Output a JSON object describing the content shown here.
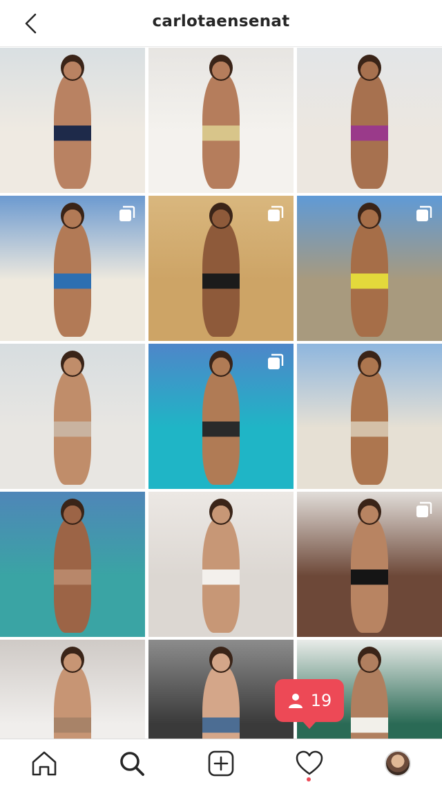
{
  "header": {
    "username": "carlotaensenat",
    "back_icon": "chevron-left-icon"
  },
  "grid": {
    "columns": 3,
    "tiles": [
      {
        "id": "post-1",
        "multi": false,
        "sky": "#d9dfe2",
        "ground": "#efeae2",
        "fig": "#b98262",
        "accent": "#1e2a4a"
      },
      {
        "id": "post-2",
        "multi": false,
        "sky": "#e7e5e2",
        "ground": "#f4f2ee",
        "fig": "#b57d5c",
        "accent": "#d8c58a"
      },
      {
        "id": "post-3",
        "multi": false,
        "sky": "#e3e6e8",
        "ground": "#ece7e0",
        "fig": "#a7714f",
        "accent": "#9a3a8a"
      },
      {
        "id": "post-4",
        "multi": true,
        "sky": "#6c9ad0",
        "ground": "#eee9de",
        "fig": "#b27a56",
        "accent": "#2d6fb1"
      },
      {
        "id": "post-5",
        "multi": true,
        "sky": "#d9b77e",
        "ground": "#cda466",
        "fig": "#8e5a3a",
        "accent": "#1b1b1b"
      },
      {
        "id": "post-6",
        "multi": true,
        "sky": "#5f9ad6",
        "ground": "#a89a7e",
        "fig": "#a66e48",
        "accent": "#e3d93b"
      },
      {
        "id": "post-7",
        "multi": false,
        "sky": "#d7dde0",
        "ground": "#e8e6e2",
        "fig": "#c08d6a",
        "accent": "#c9b3a0"
      },
      {
        "id": "post-8",
        "multi": true,
        "sky": "#4e86c9",
        "ground": "#1fb5c6",
        "fig": "#b07b55",
        "accent": "#2a2a2a"
      },
      {
        "id": "post-9",
        "multi": false,
        "sky": "#8eb6de",
        "ground": "#e6e0d4",
        "fig": "#ad764f",
        "accent": "#d4c0a8"
      },
      {
        "id": "post-10",
        "multi": false,
        "sky": "#4f86b8",
        "ground": "#3aa4a4",
        "fig": "#9c6446",
        "accent": "#b8876a"
      },
      {
        "id": "post-11",
        "multi": false,
        "sky": "#ece8e4",
        "ground": "#dcd7d2",
        "fig": "#c79776",
        "accent": "#f3f0ec"
      },
      {
        "id": "post-12",
        "multi": true,
        "sky": "#e1ddd9",
        "ground": "#6d4838",
        "fig": "#b88462",
        "accent": "#151515"
      },
      {
        "id": "post-13",
        "multi": false,
        "sky": "#cfcac6",
        "ground": "#f0eeec",
        "fig": "#c79574",
        "accent": "#a88368"
      },
      {
        "id": "post-14",
        "multi": false,
        "sky": "#8c8c8c",
        "ground": "#3a3a3a",
        "fig": "#d4a689",
        "accent": "#4c6d93"
      },
      {
        "id": "post-15",
        "multi": false,
        "sky": "#e9ece9",
        "ground": "#2a6a55",
        "fig": "#b07f5f",
        "accent": "#f2f0ea"
      }
    ]
  },
  "notification": {
    "icon": "person-icon",
    "count": "19",
    "color": "#ed4956"
  },
  "tabbar": {
    "items": [
      {
        "name": "home-tab",
        "icon": "home-icon"
      },
      {
        "name": "search-tab",
        "icon": "search-icon"
      },
      {
        "name": "new-post-tab",
        "icon": "plus-square-icon"
      },
      {
        "name": "activity-tab",
        "icon": "heart-icon"
      },
      {
        "name": "profile-tab",
        "icon": "avatar"
      }
    ],
    "activity_dot_color": "#ed4956"
  }
}
